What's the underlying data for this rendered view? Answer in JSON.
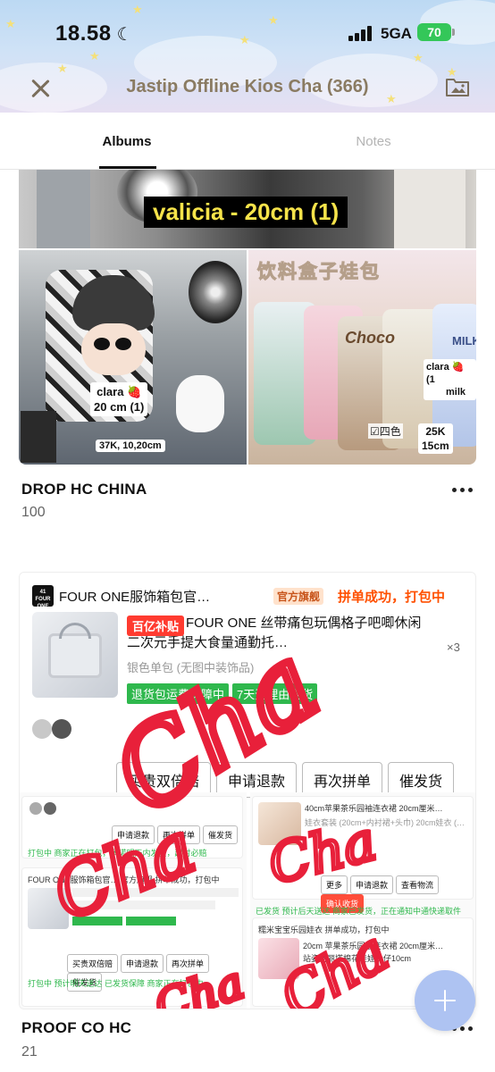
{
  "status_bar": {
    "time": "18.58",
    "network": "5GA",
    "battery": "70"
  },
  "header": {
    "title": "Jastip Offline Kios Cha (366)"
  },
  "tabs": [
    {
      "label": "Albums",
      "active": true
    },
    {
      "label": "Notes",
      "active": false
    }
  ],
  "albums": [
    {
      "title": "DROP HC CHINA",
      "count": "100",
      "cover": {
        "top_caption": "valicia - 20cm (1)",
        "left_photo": {
          "name_tag": "clara 🍓",
          "size_tag": "20 cm (1)",
          "price_tag": "37K, 10,20cm"
        },
        "right_photo": {
          "banner": "饮料盒子娃包",
          "name_tag": "clara 🍓 (1",
          "name_tag_2": "milk",
          "price_tag": "25K",
          "size_tag": "15cm",
          "checkbox_text": "☑四色"
        }
      }
    },
    {
      "title": "PROOF CO HC",
      "count": "21",
      "cover": {
        "shop_logo": "41 FOUR ONE",
        "shop_name": "FOUR ONE服饰箱包官…",
        "flagship_badge": "官方旗舰",
        "order_status": "拼单成功，打包中",
        "promo_badge": "百亿补贴",
        "item_title": "FOUR ONE 丝带痛包玩偶格子吧唧休闲二次元手提大食量通勤托…",
        "item_variant": "银色单包 (无图中装饰品)",
        "quantity": "×3",
        "services": [
          "退货包运费保障中",
          "7天无理由退货"
        ],
        "order_buttons": [
          "买贵双倍赔",
          "申请退款",
          "再次拼单",
          "催发货"
        ],
        "mini_buttons_a": [
          "申请退款",
          "再次拼单",
          "催发货"
        ],
        "mini_buttons_b": [
          "买贵双倍赔",
          "申请退款",
          "再次拼单",
          "催发货"
        ],
        "mini_buttons_c": [
          "更多",
          "申请退款",
          "查看物流",
          "确认收货"
        ],
        "mini_texts": [
          "打包中 商家正在打包，承诺明天内发货，超时必赔",
          "40cm苹果茶乐园袖连衣裙 20cm厘米…",
          "娃衣套装 (20cm+内衬裙+头巾) 20cm娃衣 (…",
          "已发货 预计后天送达 商家已发货，正在通知中通快递取件",
          "FOUR ONE服饰箱包官… 官方旗舰 拼单成功，打包中",
          "打包中 预计明天送达 已发货保障 商家正在打包中",
          "糯米宝宝乐园娃衣 拼单成功，打包中",
          "20cm 苹果茶乐园袖连衣裙 20cm厘米…",
          "站姿洛丽塔棉花娃娃公仔10cm"
        ],
        "handwriting": "Cha"
      }
    }
  ],
  "colors": {
    "header_title": "#8a7b62",
    "caption_yellow": "#f6e34a",
    "order_orange": "#ff5000",
    "service_green": "#2fb84d",
    "scribble_red": "#e8203a",
    "fab_blue": "#aec3f2"
  }
}
